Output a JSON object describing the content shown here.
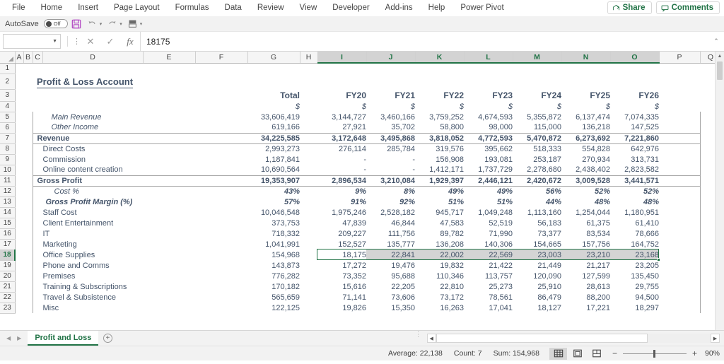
{
  "ribbon": {
    "tabs": [
      "File",
      "Home",
      "Insert",
      "Page Layout",
      "Formulas",
      "Data",
      "Review",
      "View",
      "Developer",
      "Add-ins",
      "Help",
      "Power Pivot"
    ],
    "share_label": "Share",
    "comments_label": "Comments"
  },
  "qat": {
    "autosave_label": "AutoSave",
    "autosave_state": "Off",
    "save_title": "Save",
    "undo_title": "Undo",
    "redo_title": "Redo"
  },
  "formula_bar": {
    "name_box_value": "",
    "cancel_icon": "✕",
    "enter_icon": "✓",
    "fx_icon": "fx",
    "formula_value": "18175"
  },
  "grid": {
    "columns": [
      "A",
      "B",
      "C",
      "D",
      "E",
      "F",
      "G",
      "H",
      "I",
      "J",
      "K",
      "L",
      "M",
      "N",
      "O",
      "P",
      "Q"
    ],
    "selected_columns": [
      "I",
      "J",
      "K",
      "L",
      "M",
      "N",
      "O"
    ],
    "row_numbers": [
      1,
      2,
      3,
      4,
      5,
      6,
      7,
      8,
      9,
      10,
      11,
      12,
      13,
      14,
      15,
      16,
      17,
      18,
      19,
      20,
      21,
      22,
      23
    ],
    "selected_row": 18,
    "title": "Profit & Loss Account",
    "headers": {
      "total": "Total",
      "years": [
        "FY20",
        "FY21",
        "FY22",
        "FY23",
        "FY24",
        "FY25",
        "FY26"
      ],
      "currency": "$"
    },
    "rows": [
      {
        "row": 5,
        "label": "Main Revenue",
        "style": "italic-sub",
        "values": [
          "33,606,419",
          "3,144,727",
          "3,460,166",
          "3,759,252",
          "4,674,593",
          "5,355,872",
          "6,137,474",
          "7,074,335"
        ]
      },
      {
        "row": 6,
        "label": "Other Income",
        "style": "italic-sub",
        "values": [
          "619,166",
          "27,921",
          "35,702",
          "58,800",
          "98,000",
          "115,000",
          "136,218",
          "147,525"
        ]
      },
      {
        "row": 7,
        "label": "Revenue",
        "style": "total",
        "values": [
          "34,225,585",
          "3,172,648",
          "3,495,868",
          "3,818,052",
          "4,772,593",
          "5,470,872",
          "6,273,692",
          "7,221,860"
        ]
      },
      {
        "row": 8,
        "label": "Direct Costs",
        "style": "normal",
        "values": [
          "2,993,273",
          "276,114",
          "285,784",
          "319,576",
          "395,662",
          "518,333",
          "554,828",
          "642,976"
        ]
      },
      {
        "row": 9,
        "label": "Commission",
        "style": "normal",
        "values": [
          "1,187,841",
          "-",
          "-",
          "156,908",
          "193,081",
          "253,187",
          "270,934",
          "313,731"
        ]
      },
      {
        "row": 10,
        "label": "Online content creation",
        "style": "normal",
        "values": [
          "10,690,564",
          "-",
          "-",
          "1,412,171",
          "1,737,729",
          "2,278,680",
          "2,438,402",
          "2,823,582"
        ]
      },
      {
        "row": 11,
        "label": "Gross Profit",
        "style": "total",
        "values": [
          "19,353,907",
          "2,896,534",
          "3,210,084",
          "1,929,397",
          "2,446,121",
          "2,420,672",
          "3,009,528",
          "3,441,571"
        ]
      },
      {
        "row": 12,
        "label": "Cost %",
        "style": "pct-italic",
        "values": [
          "43%",
          "9%",
          "8%",
          "49%",
          "49%",
          "56%",
          "52%",
          "52%"
        ]
      },
      {
        "row": 13,
        "label": "Gross Profit Margin (%)",
        "style": "pct-bold",
        "values": [
          "57%",
          "91%",
          "92%",
          "51%",
          "51%",
          "44%",
          "48%",
          "48%"
        ]
      },
      {
        "row": 14,
        "label": "Staff Cost",
        "style": "normal",
        "values": [
          "10,046,548",
          "1,975,246",
          "2,528,182",
          "945,717",
          "1,049,248",
          "1,113,160",
          "1,254,044",
          "1,180,951"
        ]
      },
      {
        "row": 15,
        "label": "Client Entertainment",
        "style": "normal",
        "values": [
          "373,753",
          "47,839",
          "46,844",
          "47,583",
          "52,519",
          "56,183",
          "61,375",
          "61,410"
        ]
      },
      {
        "row": 16,
        "label": "IT",
        "style": "normal",
        "values": [
          "718,332",
          "209,227",
          "111,756",
          "89,782",
          "71,990",
          "73,377",
          "83,534",
          "78,666"
        ]
      },
      {
        "row": 17,
        "label": "Marketing",
        "style": "normal",
        "values": [
          "1,041,991",
          "152,527",
          "135,777",
          "136,208",
          "140,306",
          "154,665",
          "157,756",
          "164,752"
        ]
      },
      {
        "row": 18,
        "label": "Office Supplies",
        "style": "normal",
        "values": [
          "154,968",
          "18,175",
          "22,841",
          "22,002",
          "22,569",
          "23,003",
          "23,210",
          "23,168"
        ]
      },
      {
        "row": 19,
        "label": "Phone and Comms",
        "style": "normal",
        "values": [
          "143,873",
          "17,272",
          "19,476",
          "19,832",
          "21,422",
          "21,449",
          "21,217",
          "23,205"
        ]
      },
      {
        "row": 20,
        "label": "Premises",
        "style": "normal",
        "values": [
          "776,282",
          "73,352",
          "95,688",
          "110,346",
          "113,757",
          "120,090",
          "127,599",
          "135,450"
        ]
      },
      {
        "row": 21,
        "label": "Training & Subscriptions",
        "style": "normal",
        "values": [
          "170,182",
          "15,616",
          "22,205",
          "22,810",
          "25,273",
          "25,910",
          "28,613",
          "29,755"
        ]
      },
      {
        "row": 22,
        "label": "Travel & Subsistence",
        "style": "normal",
        "values": [
          "565,659",
          "71,141",
          "73,606",
          "73,172",
          "78,561",
          "86,479",
          "88,200",
          "94,500"
        ]
      },
      {
        "row": 23,
        "label": "Misc",
        "style": "normal",
        "values": [
          "122,125",
          "19,826",
          "15,350",
          "16,263",
          "17,041",
          "18,127",
          "17,221",
          "18,297"
        ]
      }
    ]
  },
  "tabs": {
    "sheet_name": "Profit and Loss",
    "add_sheet_label": "+"
  },
  "status": {
    "average_label": "Average: 22,138",
    "count_label": "Count: 7",
    "sum_label": "Sum: 154,968",
    "zoom_label": "90%",
    "zoom_out": "−",
    "zoom_in": "+"
  },
  "colors": {
    "accent_green": "#217346",
    "text_blue": "#44546a"
  }
}
